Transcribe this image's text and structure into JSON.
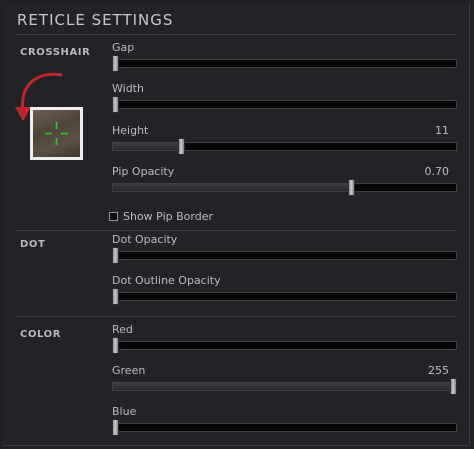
{
  "title": "RETICLE SETTINGS",
  "colors": {
    "annotation_arrow": "#c0272d",
    "crosshair_preview": "#2bd02b"
  },
  "sections": {
    "crosshair": {
      "label": "CROSSHAIR",
      "sliders": [
        {
          "label": "Gap",
          "value": "",
          "position": 0.0
        },
        {
          "label": "Width",
          "value": "",
          "position": 0.0
        },
        {
          "label": "Height",
          "value": "11",
          "position": 0.2
        },
        {
          "label": "Pip Opacity",
          "value": "0.70",
          "position": 0.7
        }
      ],
      "checkbox": {
        "label": "Show Pip Border",
        "checked": false
      }
    },
    "dot": {
      "label": "DOT",
      "sliders": [
        {
          "label": "Dot Opacity",
          "value": "",
          "position": 0.0
        },
        {
          "label": "Dot Outline Opacity",
          "value": "",
          "position": 0.0
        }
      ]
    },
    "color": {
      "label": "COLOR",
      "sliders": [
        {
          "label": "Red",
          "value": "",
          "position": 0.0
        },
        {
          "label": "Green",
          "value": "255",
          "position": 1.0
        },
        {
          "label": "Blue",
          "value": "",
          "position": 0.0
        }
      ]
    }
  }
}
